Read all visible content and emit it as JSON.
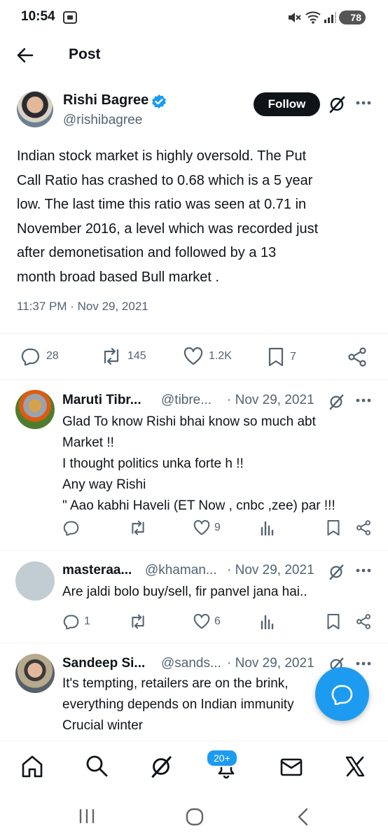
{
  "status_bar": {
    "time": "10:54",
    "battery": "78"
  },
  "header": {
    "title": "Post"
  },
  "tweet": {
    "author_name": "Rishi Bagree",
    "author_handle": "@rishibagree",
    "follow_label": "Follow",
    "lines": [
      "Indian stock market is highly oversold. The Put",
      "Call Ratio has crashed to 0.68 which is a 5 year",
      "low. The last time this ratio was seen at 0.71 in",
      "November 2016, a level which was recorded just",
      "after demonetisation and followed by a 13",
      "month broad based Bull market ."
    ],
    "timestamp": "11:37 PM · Nov 29, 2021",
    "stats": {
      "replies": "28",
      "reposts": "145",
      "likes": "1.2K",
      "bookmarks": "7"
    }
  },
  "replies": [
    {
      "name": "Maruti Tibr...",
      "handle": "@tibre...",
      "date": "· Nov 29, 2021",
      "lines": [
        "Glad To know Rishi bhai know so much abt",
        "Market !!",
        "I thought politics unka forte h !!",
        "Any way Rishi",
        "\" Aao kabhi Haveli (ET Now , cnbc ,zee) par !!!"
      ],
      "likes": "9"
    },
    {
      "name": "masteraa...",
      "handle": "@khaman...",
      "date": "· Nov 29, 2021",
      "lines": [
        "Are jaldi bolo buy/sell, fir panvel jana hai.."
      ],
      "replies": "1",
      "likes": "6"
    },
    {
      "name": "Sandeep Si...",
      "handle": "@sands...",
      "date": "· Nov 29, 2021",
      "lines": [
        "It's tempting, retailers are on the brink,",
        "everything depends on Indian immunity",
        "Crucial winter"
      ]
    }
  ],
  "tabbar": {
    "notifications_badge": "20+"
  },
  "colors": {
    "accent": "#1d9bf0",
    "text": "#0f1419",
    "muted": "#536471"
  }
}
